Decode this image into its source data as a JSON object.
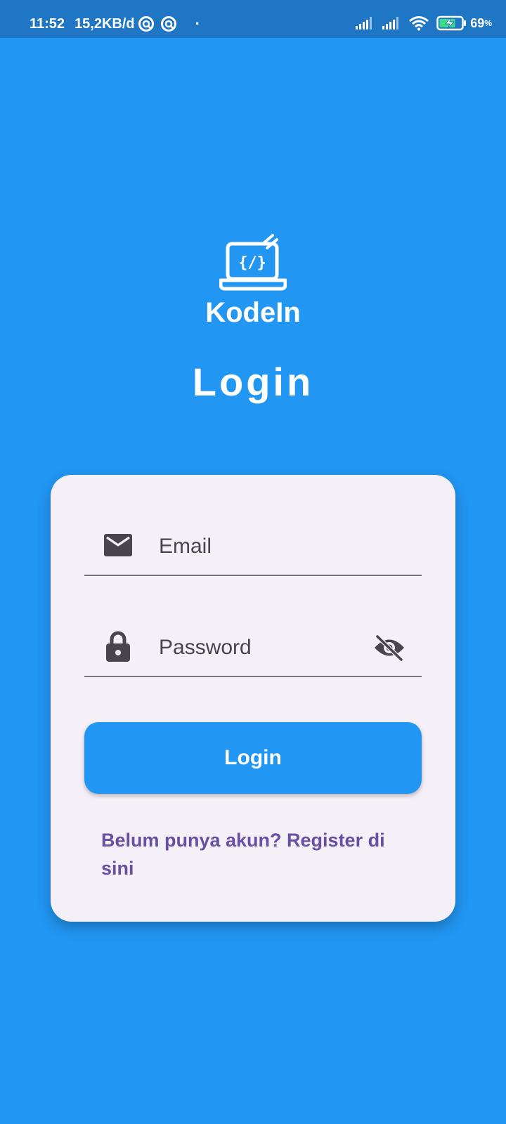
{
  "status_bar": {
    "time": "11:52",
    "net_speed": "15,2KB/d",
    "notification_dot": "·",
    "battery_percent": "69",
    "battery_unit": "%",
    "icons": [
      "notification-icon",
      "notification-icon",
      "signal-icon",
      "signal-icon",
      "wifi-icon",
      "battery-charging-icon"
    ]
  },
  "logo": {
    "icon": "laptop-code-icon",
    "text": "KodeIn"
  },
  "page_title": "Login",
  "form": {
    "email": {
      "icon": "mail-icon",
      "placeholder": "Email",
      "value": ""
    },
    "password": {
      "icon": "lock-icon",
      "placeholder": "Password",
      "value": "",
      "toggle_icon": "visibility-off-icon"
    },
    "login_label": "Login",
    "register_link": "Belum punya akun? Register di sini"
  },
  "colors": {
    "background": "#2196F3",
    "status_bar": "#1E76C4",
    "card": "#F5EFF7",
    "icon": "#49454F",
    "link": "#6750A4",
    "button": "#2196F3"
  }
}
